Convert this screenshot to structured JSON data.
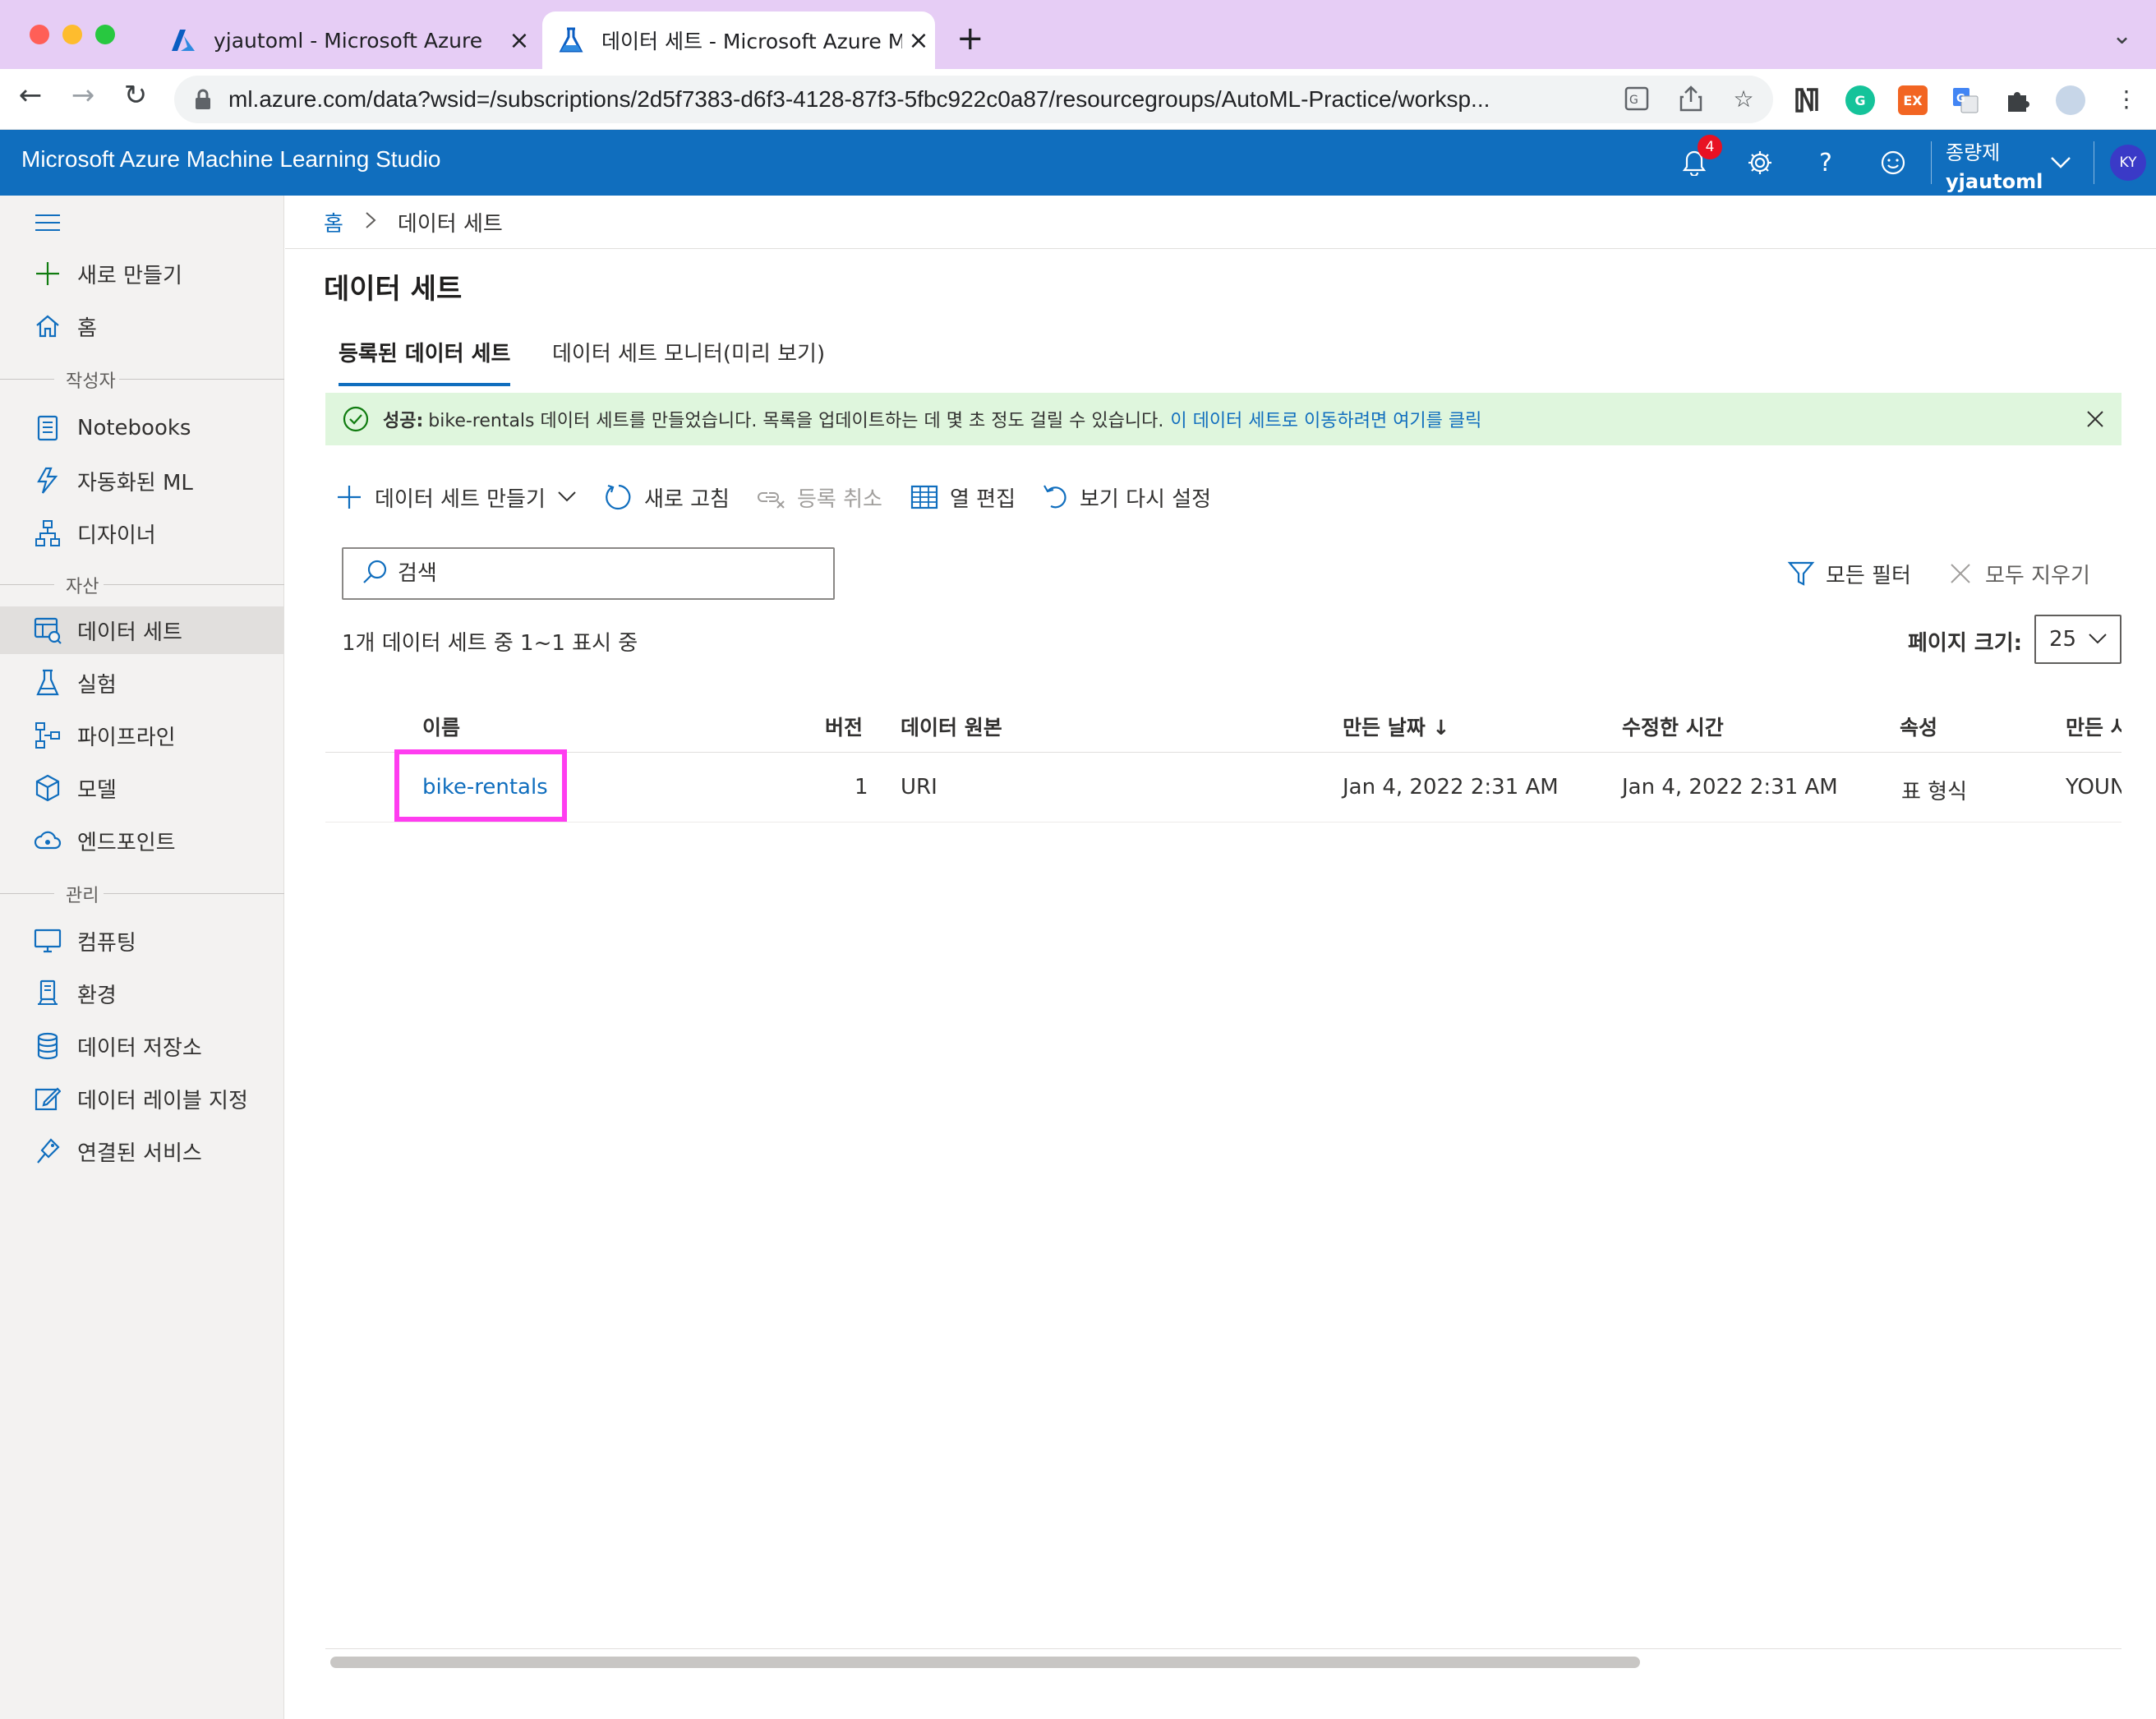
{
  "browser": {
    "tabs": [
      {
        "title": "yjautoml - Microsoft Azure",
        "icon": "azure-logo-icon",
        "active": false
      },
      {
        "title": "데이터 세트 - Microsoft Azure Ma",
        "icon": "flask-icon",
        "active": true
      }
    ],
    "url": "ml.azure.com/data?wsid=/subscriptions/2d5f7383-d6f3-4128-87f3-5fbc922c0a87/resourcegroups/AutoML-Practice/worksp...",
    "extensions": [
      "notion-icon",
      "grammarly-icon",
      "ex-extension-icon",
      "google-translate-icon",
      "puzzle-icon",
      "profile-avatar-icon"
    ],
    "extension_labels": {
      "ex": "EX"
    }
  },
  "header": {
    "brand": "Microsoft Azure Machine Learning Studio",
    "notification_count": "4",
    "directory": "종량제",
    "workspace": "yjautoml",
    "avatar_initials": "KY",
    "accent": "#106ebe"
  },
  "sidebar": {
    "new_label": "새로 만들기",
    "home_label": "홈",
    "sections": {
      "author": "작성자",
      "assets": "자산",
      "manage": "관리"
    },
    "author_items": [
      "Notebooks",
      "자동화된 ML",
      "디자이너"
    ],
    "asset_items": [
      "데이터 세트",
      "실험",
      "파이프라인",
      "모델",
      "엔드포인트"
    ],
    "manage_items": [
      "컴퓨팅",
      "환경",
      "데이터 저장소",
      "데이터 레이블 지정",
      "연결된 서비스"
    ]
  },
  "breadcrumb": {
    "home": "홈",
    "current": "데이터 세트"
  },
  "page": {
    "title": "데이터 세트",
    "tabs": [
      "등록된 데이터 세트",
      "데이터 세트 모니터(미리 보기)"
    ]
  },
  "message": {
    "bold": "성공:",
    "text": "bike-rentals 데이터 세트를 만들었습니다. 목록을 업데이트하는 데 몇 초 정도 걸릴 수 있습니다.",
    "link": "이 데이터 세트로 이동하려면 여기를 클릭",
    "color": "#dff6dd"
  },
  "toolbar": {
    "create": "데이터 세트 만들기",
    "refresh": "새로 고침",
    "unregister": "등록 취소",
    "edit_columns": "열 편집",
    "reset_view": "보기 다시 설정"
  },
  "search": {
    "placeholder": "검색"
  },
  "filters": {
    "all_filters": "모든 필터",
    "clear_all": "모두 지우기"
  },
  "list": {
    "count_text": "1개 데이터 세트 중 1~1 표시 중",
    "page_size_label": "페이지 크기:",
    "page_size": "25",
    "columns": [
      "이름",
      "버전",
      "데이터 원본",
      "만든 날짜 ↓",
      "수정한 시간",
      "속성",
      "만든 사"
    ],
    "rows": [
      [
        "bike-rentals",
        "1",
        "URI",
        "Jan 4, 2022 2:31 AM",
        "Jan 4, 2022 2:31 AM",
        "표 형식",
        "YOUN"
      ]
    ],
    "highlight_color": "#ff3df0"
  }
}
